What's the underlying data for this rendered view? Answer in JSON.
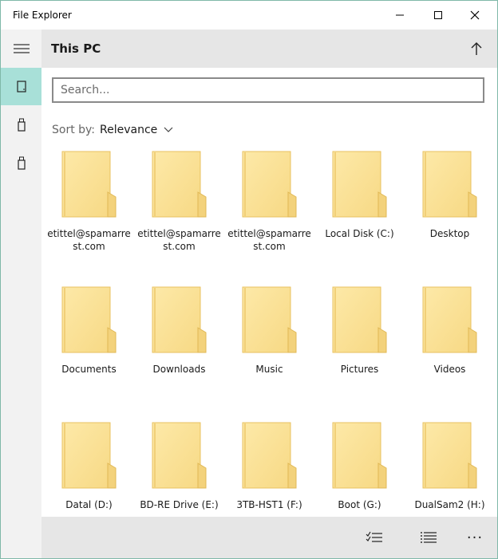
{
  "window": {
    "title": "File Explorer"
  },
  "header": {
    "title": "This PC"
  },
  "search": {
    "placeholder": "Search..."
  },
  "sort": {
    "label": "Sort by:",
    "value": "Relevance"
  },
  "items": [
    {
      "label": "etittel@spamarrest.com"
    },
    {
      "label": "etittel@spamarrest.com"
    },
    {
      "label": "etittel@spamarrest.com"
    },
    {
      "label": "Local Disk (C:)"
    },
    {
      "label": "Desktop"
    },
    {
      "label": "Documents"
    },
    {
      "label": "Downloads"
    },
    {
      "label": "Music"
    },
    {
      "label": "Pictures"
    },
    {
      "label": "Videos"
    },
    {
      "label": "Datal (D:)"
    },
    {
      "label": "BD-RE Drive (E:)"
    },
    {
      "label": "3TB-HST1 (F:)"
    },
    {
      "label": "Boot (G:)"
    },
    {
      "label": "DualSam2 (H:)"
    }
  ],
  "command_bar": {
    "more_label": "···"
  },
  "colors": {
    "accent_selected": "#a8e0d8",
    "folder_fill": "#fbe39a",
    "folder_edge": "#e8c160"
  },
  "icons": {
    "rail": [
      "hamburger-icon",
      "device-icon",
      "usb-drive-icon",
      "usb-drive-icon"
    ],
    "header": "up-arrow-icon",
    "commands": [
      "select-list-icon",
      "list-view-icon",
      "more-icon"
    ]
  }
}
